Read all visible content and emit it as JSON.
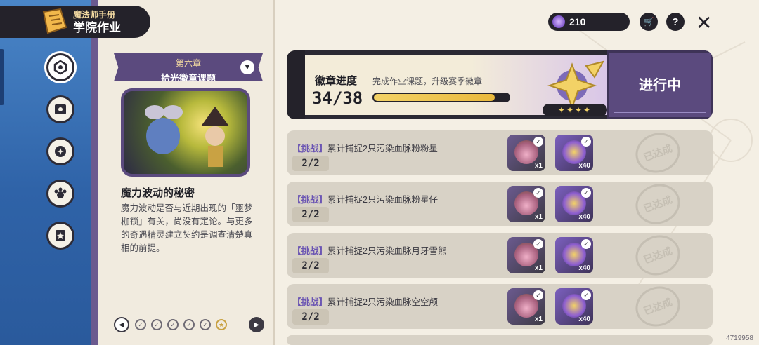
{
  "header": {
    "subtitle": "魔法师手册",
    "title": "学院作业"
  },
  "nav": [
    {
      "icon": "badge-icon",
      "active": true
    },
    {
      "icon": "pet-card-icon",
      "active": false
    },
    {
      "icon": "magic-orb-icon",
      "active": false
    },
    {
      "icon": "paw-icon",
      "active": false
    },
    {
      "icon": "star-card-icon",
      "active": false
    }
  ],
  "chapter": {
    "number": "第六章",
    "name": "拾光徽章课题",
    "dropdown_icon": "▼"
  },
  "story": {
    "title": "魔力波动的秘密",
    "text": "魔力波动是否与近期出现的「噩梦枷锁」有关，尚没有定论。与更多的奇遇精灵建立契约是调查清楚真相的前提。"
  },
  "pager": {
    "prev": "◀",
    "next": "▶",
    "dots": [
      "✓",
      "✓",
      "✓",
      "✓",
      "✓",
      "★"
    ]
  },
  "currency": {
    "value": "210"
  },
  "top_buttons": {
    "cart": "🛒",
    "help": "?",
    "close": "✕"
  },
  "badge": {
    "title": "徽章进度",
    "subtitle": "完成作业课题，升级赛季徽章",
    "progress_text": "34/38",
    "progress_fraction": 0.895,
    "stars": "✦✦✦✦",
    "status": "进行中"
  },
  "tasks": [
    {
      "tag": "【挑战】",
      "text": "累计捕捉2只污染血脉粉粉星",
      "count": "2/2",
      "reward1_qty": "x1",
      "reward2_qty": "x40",
      "done": "已达成"
    },
    {
      "tag": "【挑战】",
      "text": "累计捕捉2只污染血脉粉星仔",
      "count": "2/2",
      "reward1_qty": "x1",
      "reward2_qty": "x40",
      "done": "已达成"
    },
    {
      "tag": "【挑战】",
      "text": "累计捕捉2只污染血脉月牙雪熊",
      "count": "2/2",
      "reward1_qty": "x1",
      "reward2_qty": "x40",
      "done": "已达成"
    },
    {
      "tag": "【挑战】",
      "text": "累计捕捉2只污染血脉空空颅",
      "count": "2/2",
      "reward1_qty": "x1",
      "reward2_qty": "x40",
      "done": "已达成"
    }
  ],
  "uid": "4719958"
}
